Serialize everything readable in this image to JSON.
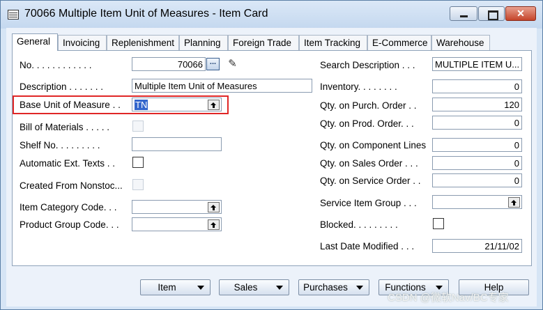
{
  "window": {
    "title": "70066 Multiple Item Unit of Measures - Item Card"
  },
  "tabs": [
    "General",
    "Invoicing",
    "Replenishment",
    "Planning",
    "Foreign Trade",
    "Item Tracking",
    "E-Commerce",
    "Warehouse"
  ],
  "left": {
    "no_label": "No. . . . . . . . . . . .",
    "no_value": "70066",
    "ellipsis": "...",
    "description_label": "Description . . . . . . .",
    "description_value": "Multiple Item Unit of Measures",
    "base_uom_label": "Base Unit of Measure . .",
    "base_uom_value": "TN",
    "bom_label": "Bill of Materials . . . . .",
    "shelf_label": "Shelf No. . . . . . . . .",
    "shelf_value": "",
    "auto_ext_label": "Automatic Ext. Texts . .",
    "created_from_label": "Created From Nonstoc...",
    "item_cat_label": "Item Category Code. . .",
    "item_cat_value": "",
    "product_group_label": "Product Group Code. . .",
    "product_group_value": ""
  },
  "right": {
    "search_label": "Search Description . . .",
    "search_value": "MULTIPLE ITEM U...",
    "inventory_label": "Inventory. . . . . . . .",
    "inventory_value": "0",
    "purch_label": "Qty. on Purch. Order . .",
    "purch_value": "120",
    "prod_label": "Qty. on Prod. Order. . .",
    "prod_value": "0",
    "component_label": "Qty. on Component Lines",
    "component_value": "0",
    "sales_label": "Qty. on Sales Order . . .",
    "sales_value": "0",
    "service_label": "Qty. on Service Order . .",
    "service_value": "0",
    "service_group_label": "Service Item Group . . .",
    "service_group_value": "",
    "blocked_label": "Blocked. . . . . . . . .",
    "last_modified_label": "Last Date Modified . . .",
    "last_modified_value": "21/11/02"
  },
  "buttons": {
    "item": "Item",
    "sales": "Sales",
    "purchases": "Purchases",
    "functions": "Functions",
    "help": "Help"
  },
  "watermark": "CSDN @微软Nav/BC专家"
}
